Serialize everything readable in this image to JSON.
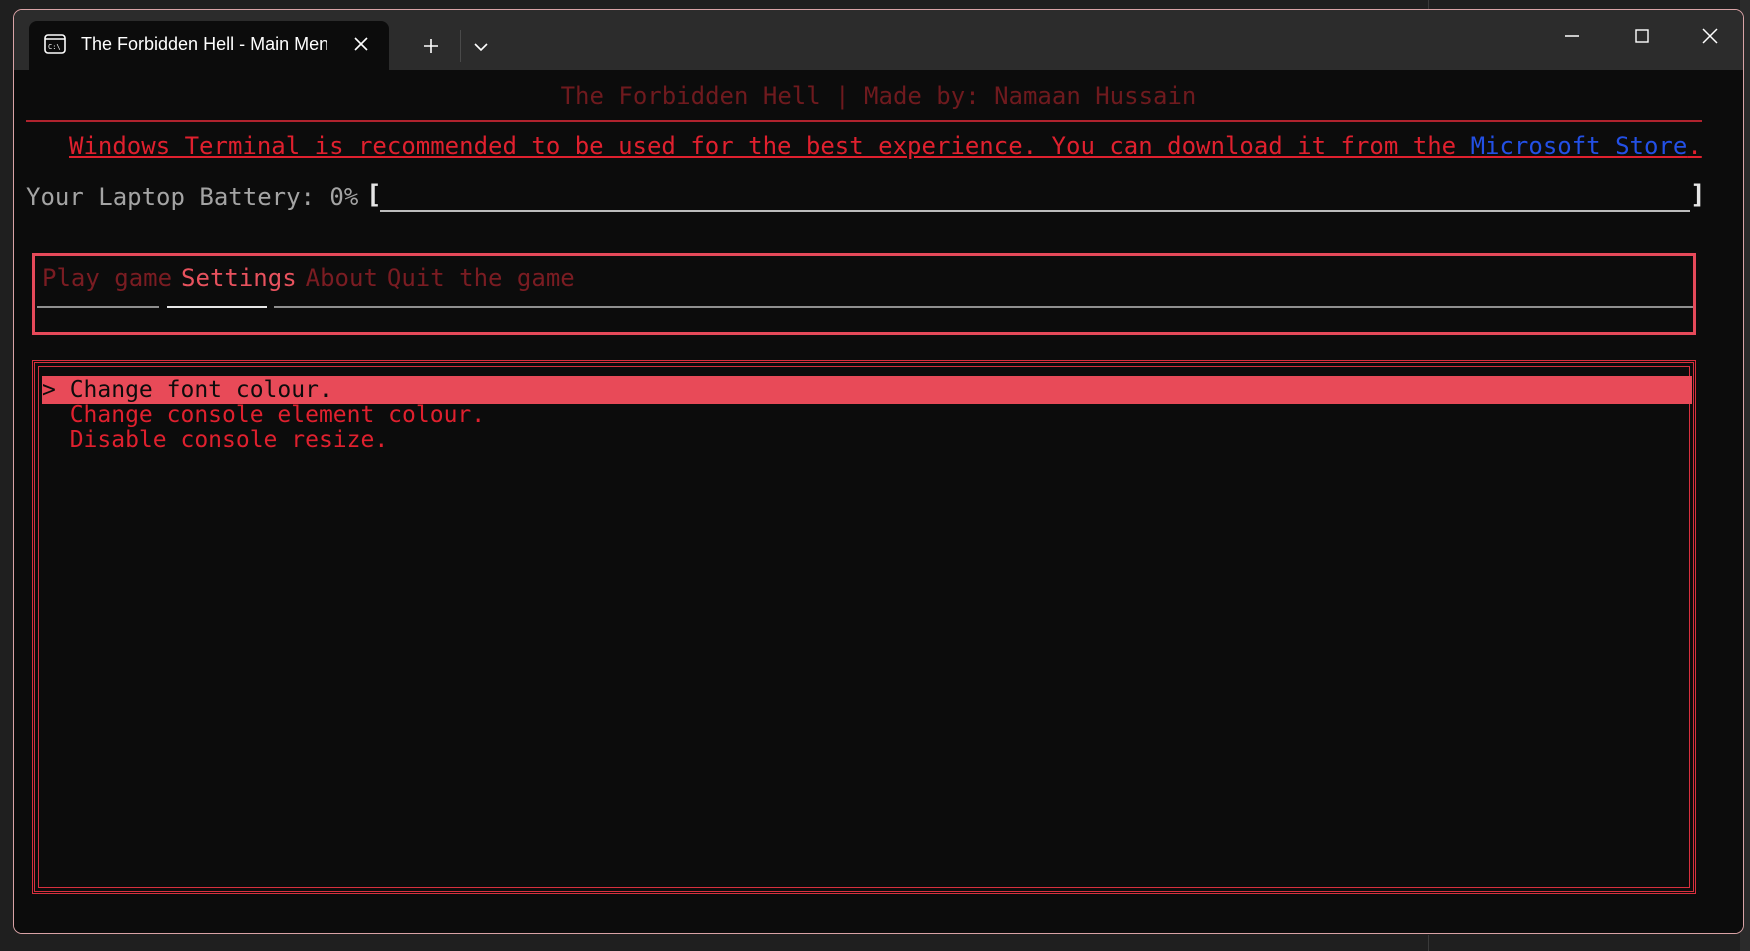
{
  "window": {
    "tab_title": "The Forbidden Hell - Main Menu"
  },
  "header": {
    "text": "The Forbidden Hell | Made by: Namaan Hussain"
  },
  "notice": {
    "text": "Windows Terminal is recommended to be used for the best experience. You can download it from the ",
    "store_link": "Microsoft Store",
    "suffix": "."
  },
  "battery": {
    "label": "Your Laptop Battery: 0%",
    "bracket_open": "[",
    "bracket_close": "]",
    "level_percent": 0
  },
  "menu": {
    "tabs": [
      {
        "label": "Play game",
        "active": false
      },
      {
        "label": "Settings",
        "active": true
      },
      {
        "label": "About",
        "active": false
      },
      {
        "label": "Quit the game",
        "active": false
      }
    ]
  },
  "settings": {
    "options": [
      {
        "label": "> Change font colour.",
        "selected": true
      },
      {
        "label": "  Change console element colour.",
        "selected": false
      },
      {
        "label": "  Disable console resize.",
        "selected": false
      }
    ]
  },
  "colors": {
    "accent": "#e84a58",
    "text_red": "#e0202e",
    "link_blue": "#2350e6",
    "background": "#0c0c0c"
  },
  "icons": {
    "tab": "terminal-icon",
    "close": "close-icon",
    "new_tab": "plus-icon",
    "dropdown": "chevron-down-icon",
    "minimize": "minimize-icon",
    "maximize": "maximize-icon",
    "window_close": "close-icon"
  }
}
